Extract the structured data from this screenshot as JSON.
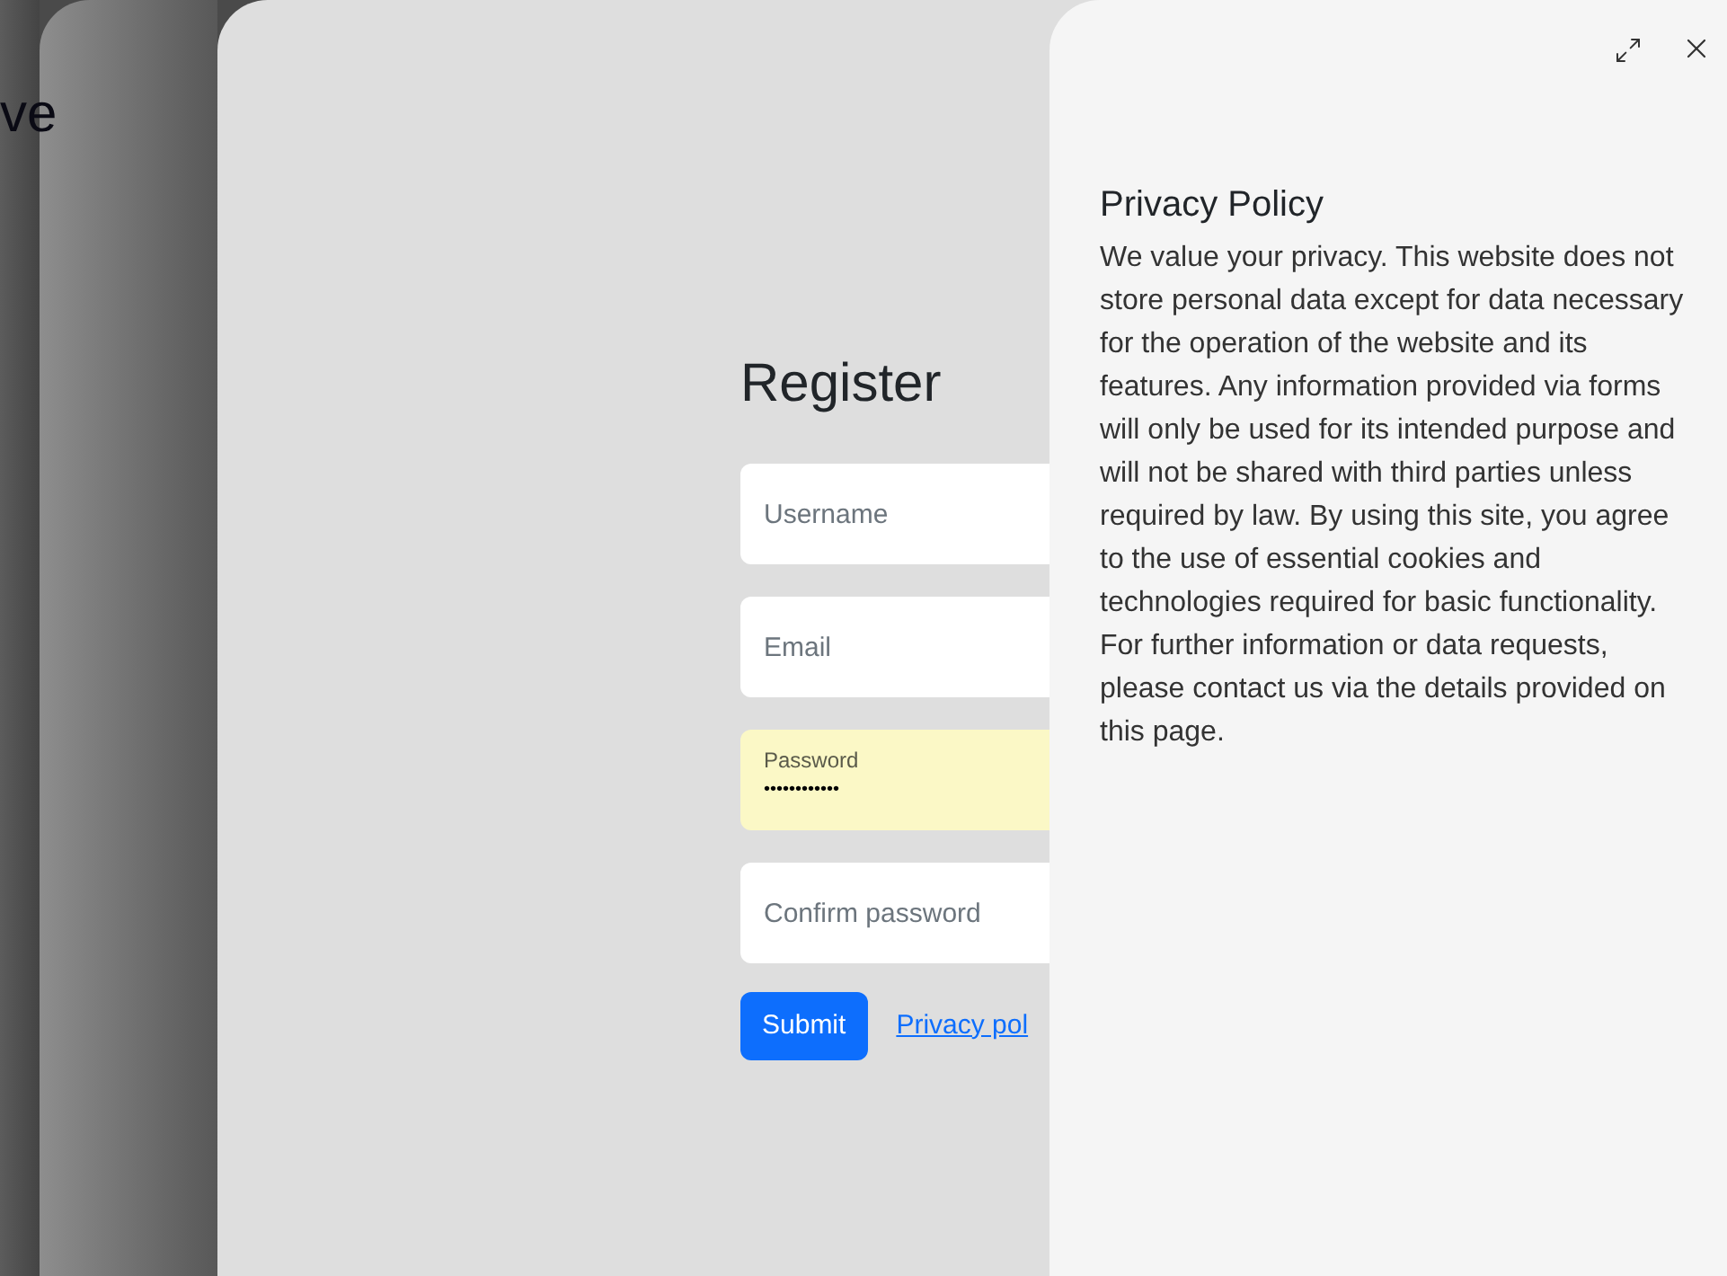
{
  "background_heading": "ve",
  "register": {
    "title": "Register",
    "fields": [
      {
        "kind": "empty",
        "placeholder": "Username",
        "autofilled": false
      },
      {
        "kind": "empty",
        "placeholder": "Email",
        "autofilled": false
      },
      {
        "kind": "filled",
        "label": "Password",
        "value": "••••••••••••",
        "autofilled": true
      },
      {
        "kind": "empty",
        "placeholder": "Confirm password",
        "autofilled": false
      }
    ],
    "submit": "Submit",
    "link": "Privacy pol"
  },
  "drawer": {
    "title": "Privacy Policy",
    "body": "We value your privacy. This website does not store personal data except for data necessary for the operation of the website and its features. Any information provided via forms will only be used for its intended purpose and will not be shared with third parties unless required by law. By using this site, you agree to the use of essential cookies and technologies required for basic functionality. For further information or data requests, please contact us via the details provided on this page."
  }
}
